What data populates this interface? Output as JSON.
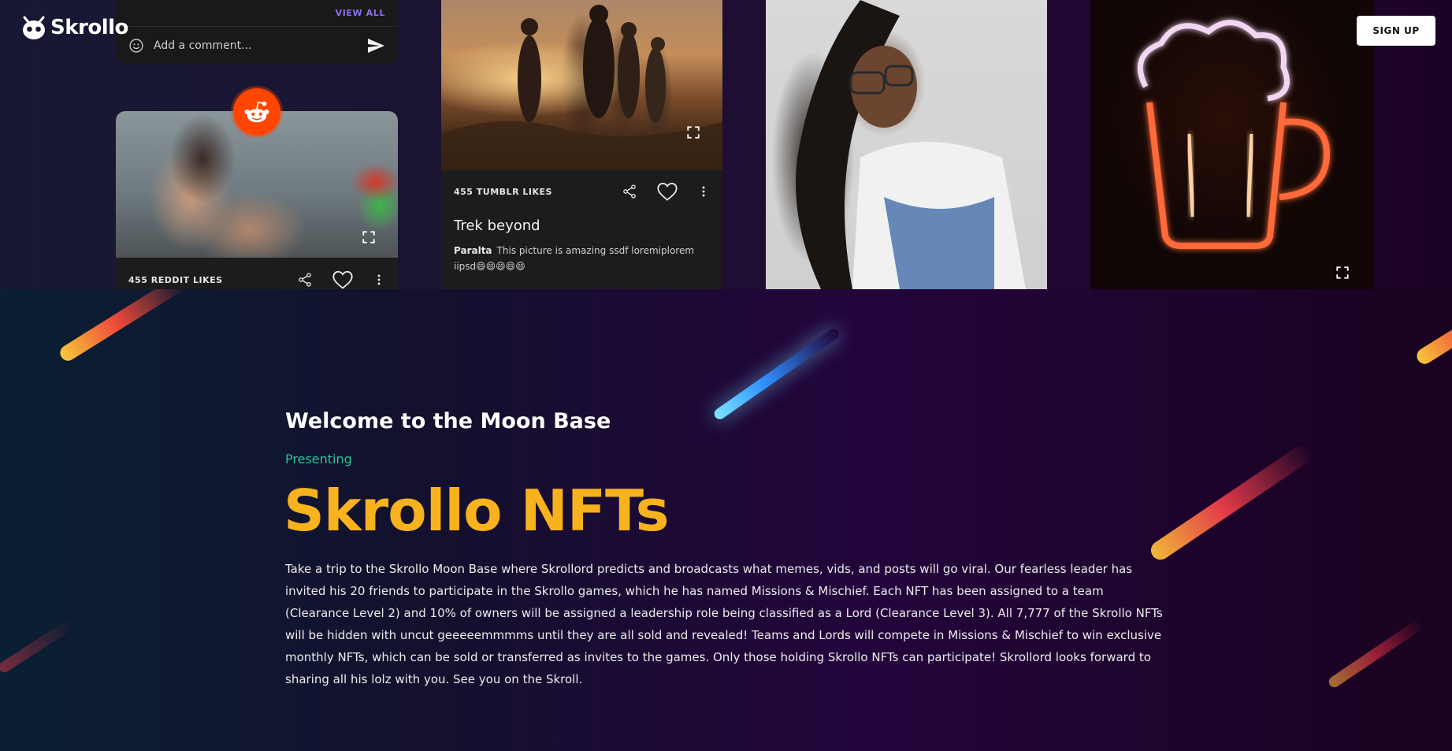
{
  "header": {
    "logo_text": "Skrollo",
    "signup_label": "SIGN UP"
  },
  "gallery": {
    "comment_card": {
      "view_all_label": "VIEW ALL",
      "comment_placeholder": "Add a comment..."
    },
    "reddit_card": {
      "likes_label": "455 REDDIT LIKES"
    },
    "tumblr_card": {
      "likes_label": "455 TUMBLR LIKES",
      "title": "Trek beyond",
      "caption_author": "Paralta",
      "caption_text": "This picture is amazing ssdf loremiplorem iipsd😄😄😄😄😄"
    }
  },
  "hero": {
    "welcome_heading": "Welcome to the Moon Base",
    "presenting_label": "Presenting",
    "title": "Skrollo NFTs",
    "paragraph": "Take a trip to the Skrollo Moon Base where Skrollord predicts and broadcasts what memes, vids, and posts will go viral. Our fearless leader has invited his 20 friends to participate in the Skrollo games, which he has named Missions & Mischief. Each NFT has been assigned to a team (Clearance Level 2) and 10% of owners will be assigned a leadership role being classified as a Lord (Clearance Level 3). All 7,777 of the Skrollo NFTs will be hidden with uncut geeeeemmmms until they are all sold and revealed! Teams and Lords will compete in Missions & Mischief to win exclusive monthly NFTs, which can be sold or transferred as invites to the games. Only those holding Skrollo NFTs can participate! Skrollord looks forward to sharing all his lolz with you. See you on the Skroll."
  },
  "colors": {
    "accent_yellow": "#f7b21d",
    "accent_green": "#2bc394",
    "link_purple": "#8b6ff0",
    "reddit_orange": "#ff4500"
  }
}
